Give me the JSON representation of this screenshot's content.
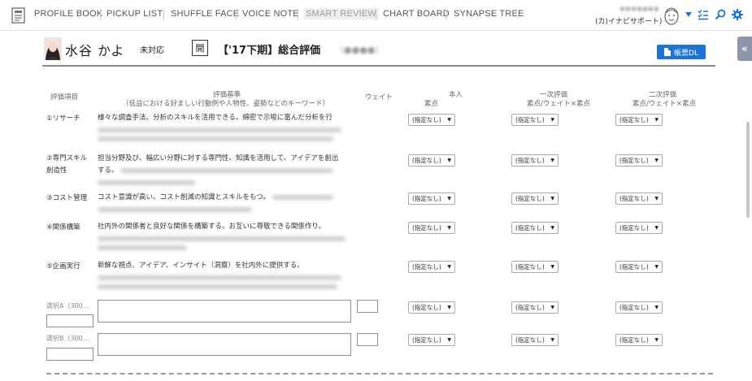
{
  "nav": {
    "items": [
      "PROFILE BOOK",
      "PICKUP LIST",
      "SHUFFLE FACE",
      "VOICE NOTE",
      "SMART REVIEW",
      "CHART BOARD",
      "SYNAPSE TREE"
    ],
    "active": "SMART REVIEW",
    "support_name": "(カ)イナビサポート)"
  },
  "icons": {
    "logo": "profile-book-logo",
    "avatar": "avatar-face",
    "caret": "caret-down-icon",
    "list": "list-check-icon",
    "search": "search-icon",
    "settings": "gear-icon",
    "collapse": "double-chevron-left-icon",
    "download": "document-icon"
  },
  "colors": {
    "accent": "#1e73d2",
    "nav_active_bg": "#efefef",
    "toggle_bg": "#8c96a8"
  },
  "person": {
    "name": "水谷 かよ",
    "status": "未対応"
  },
  "review": {
    "badge": "開",
    "title": "【'17下期】総合評価"
  },
  "download_label": "帳票DL",
  "table": {
    "headers": {
      "item": "評価項目",
      "criteria": "評価基準",
      "criteria_sub": "（低益における好ましい行動例や人物性、姿勢などのキーワード）",
      "weight": "ウェイト",
      "self": "本人",
      "self_sub": "素点",
      "first": "一次評価",
      "first_sub": "素点/ウェイト×素点",
      "second": "二次評価",
      "second_sub": "素点/ウェイト×素点"
    },
    "select_value": "(指定なし)",
    "rows": [
      {
        "label": "①リサーチ",
        "criteria": "様々な調査手法、分析のスキルを活用できる。綿密で示唆に富んだ分析を行"
      },
      {
        "label": "②専門スキル",
        "label2": "創造性",
        "criteria": "担当分野及び、幅広い分野に対する専門性、知識を活用して、アイデアを創出"
      },
      {
        "label": "③コスト管理",
        "criteria": "コスト意識が高い。コスト削減の知識とスキルをもつ。"
      },
      {
        "label": "④関係構築",
        "criteria": "社内外の関係者と良好な関係を構築する。お互いに尊敬できる関係作り。"
      },
      {
        "label": "⑤企画実行",
        "criteria": "新鮮な視点、アイデア、インサイト（洞察）を社内外に提供する。"
      }
    ],
    "optional": [
      {
        "label": "選択A（300…"
      },
      {
        "label": "選択B（300…"
      }
    ]
  }
}
